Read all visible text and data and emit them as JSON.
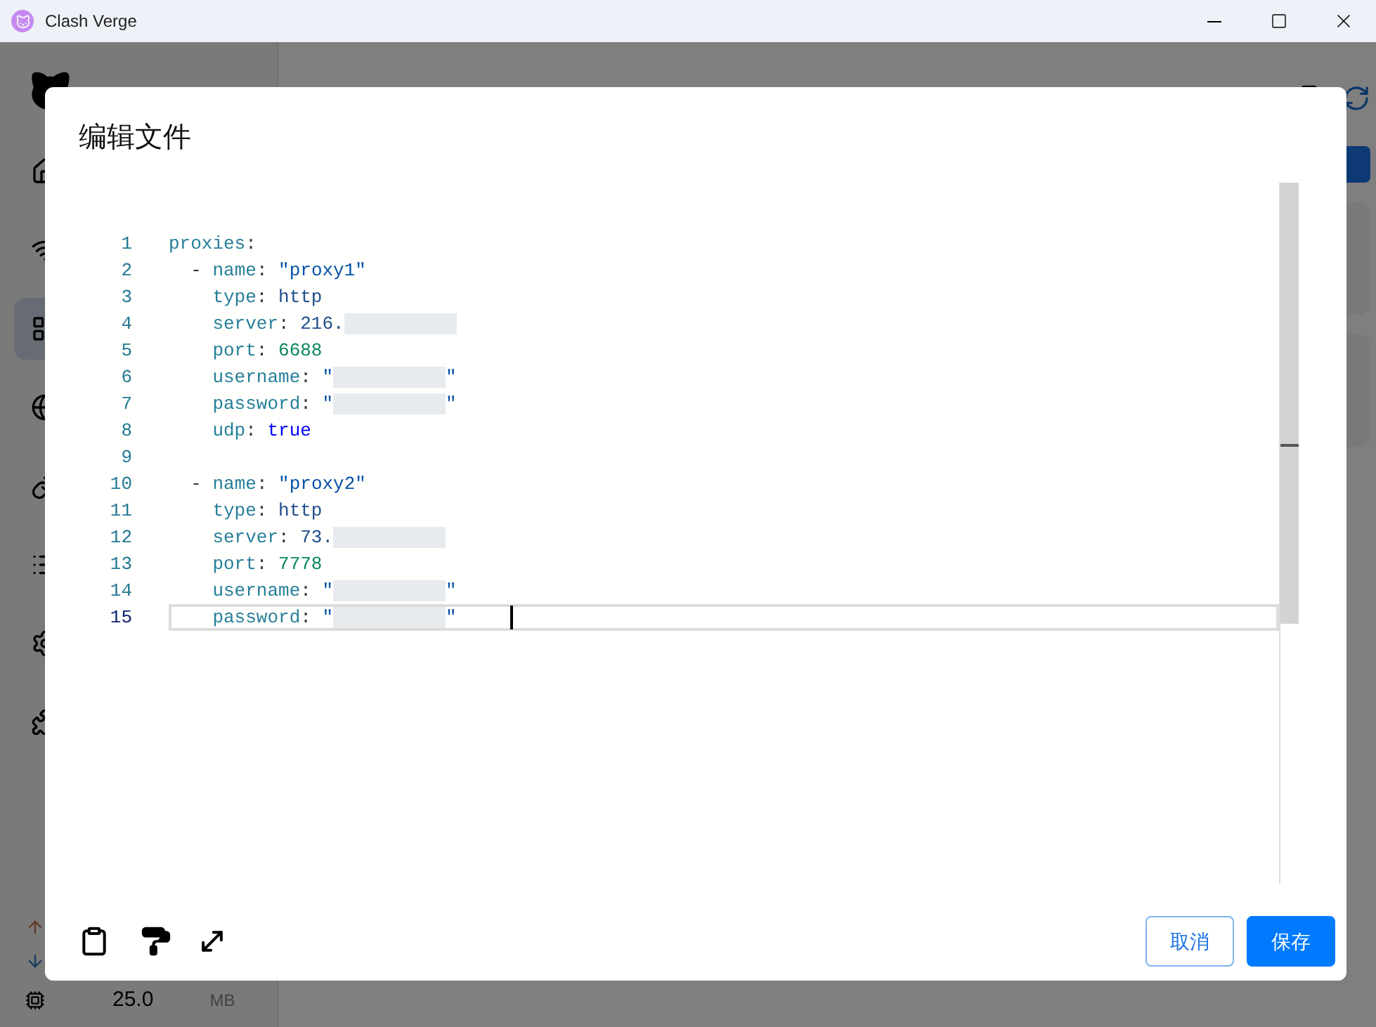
{
  "window": {
    "title": "Clash Verge"
  },
  "sidebar": {
    "items": [
      {
        "selected": false
      },
      {
        "selected": false
      },
      {
        "selected": true
      },
      {
        "selected": false
      },
      {
        "selected": false
      },
      {
        "selected": false
      },
      {
        "selected": false
      },
      {
        "selected": false
      }
    ]
  },
  "traffic": {
    "memory": "25.0",
    "unit": "MB"
  },
  "dialog": {
    "title": "编辑文件",
    "editor": {
      "lines": [
        {
          "number": "1",
          "current": false,
          "segments": [
            {
              "kind": "key",
              "text": "proxies"
            },
            {
              "kind": "punct",
              "text": ":"
            }
          ]
        },
        {
          "number": "2",
          "current": false,
          "segments": [
            {
              "kind": "punct",
              "text": "  - "
            },
            {
              "kind": "key",
              "text": "name"
            },
            {
              "kind": "punct",
              "text": ": "
            },
            {
              "kind": "string",
              "text": "\"proxy1\""
            }
          ]
        },
        {
          "number": "3",
          "current": false,
          "segments": [
            {
              "kind": "key",
              "text": "    type"
            },
            {
              "kind": "punct",
              "text": ": "
            },
            {
              "kind": "value",
              "text": "http"
            }
          ]
        },
        {
          "number": "4",
          "current": false,
          "segments": [
            {
              "kind": "key",
              "text": "    server"
            },
            {
              "kind": "punct",
              "text": ": "
            },
            {
              "kind": "value",
              "text": "216."
            },
            {
              "kind": "redacted"
            }
          ]
        },
        {
          "number": "5",
          "current": false,
          "segments": [
            {
              "kind": "key",
              "text": "    port"
            },
            {
              "kind": "punct",
              "text": ": "
            },
            {
              "kind": "number",
              "text": "6688"
            }
          ]
        },
        {
          "number": "6",
          "current": false,
          "segments": [
            {
              "kind": "key",
              "text": "    username"
            },
            {
              "kind": "punct",
              "text": ": "
            },
            {
              "kind": "string",
              "text": "\""
            },
            {
              "kind": "redacted"
            },
            {
              "kind": "string",
              "text": "\""
            }
          ]
        },
        {
          "number": "7",
          "current": false,
          "segments": [
            {
              "kind": "key",
              "text": "    password"
            },
            {
              "kind": "punct",
              "text": ": "
            },
            {
              "kind": "string",
              "text": "\""
            },
            {
              "kind": "redacted"
            },
            {
              "kind": "string",
              "text": "\""
            }
          ]
        },
        {
          "number": "8",
          "current": false,
          "segments": [
            {
              "kind": "key",
              "text": "    udp"
            },
            {
              "kind": "punct",
              "text": ": "
            },
            {
              "kind": "keyword",
              "text": "true"
            }
          ]
        },
        {
          "number": "9",
          "current": false
        },
        {
          "number": "10",
          "current": false,
          "segments": [
            {
              "kind": "punct",
              "text": "  - "
            },
            {
              "kind": "key",
              "text": "name"
            },
            {
              "kind": "punct",
              "text": ": "
            },
            {
              "kind": "string",
              "text": "\"proxy2\""
            }
          ]
        },
        {
          "number": "11",
          "current": false,
          "segments": [
            {
              "kind": "key",
              "text": "    type"
            },
            {
              "kind": "punct",
              "text": ": "
            },
            {
              "kind": "value",
              "text": "http"
            }
          ]
        },
        {
          "number": "12",
          "current": false,
          "segments": [
            {
              "kind": "key",
              "text": "    server"
            },
            {
              "kind": "punct",
              "text": ": "
            },
            {
              "kind": "value",
              "text": "73."
            },
            {
              "kind": "redacted"
            }
          ]
        },
        {
          "number": "13",
          "current": false,
          "segments": [
            {
              "kind": "key",
              "text": "    port"
            },
            {
              "kind": "punct",
              "text": ": "
            },
            {
              "kind": "number",
              "text": "7778"
            }
          ]
        },
        {
          "number": "14",
          "current": false,
          "segments": [
            {
              "kind": "key",
              "text": "    username"
            },
            {
              "kind": "punct",
              "text": ": "
            },
            {
              "kind": "string",
              "text": "\""
            },
            {
              "kind": "redacted"
            },
            {
              "kind": "string",
              "text": "\""
            }
          ]
        },
        {
          "number": "15",
          "current": true,
          "segments": [
            {
              "kind": "key",
              "text": "    password"
            },
            {
              "kind": "punct",
              "text": ": "
            },
            {
              "kind": "string",
              "text": "\""
            },
            {
              "kind": "redacted"
            },
            {
              "kind": "string",
              "text": "\""
            }
          ]
        }
      ]
    },
    "buttons": [
      {
        "label": "取消",
        "kind": "outline"
      },
      {
        "label": "保存",
        "kind": "primary"
      }
    ]
  }
}
